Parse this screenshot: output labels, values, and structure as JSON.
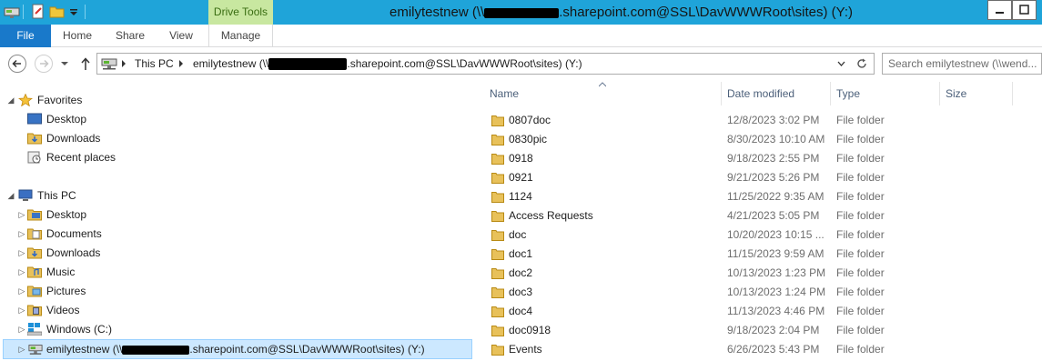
{
  "ribbon": {
    "context_tab": "Drive Tools",
    "tabs": [
      "File",
      "Home",
      "Share",
      "View",
      "Manage"
    ]
  },
  "window": {
    "title_pre": "emilytestnew (\\\\",
    "title_post": ".sharepoint.com@SSL\\DavWWWRoot\\sites) (Y:)"
  },
  "address": {
    "crumb1": "This PC",
    "crumb2_pre": "emilytestnew (\\\\",
    "crumb2_post": ".sharepoint.com@SSL\\DavWWWRoot\\sites) (Y:)"
  },
  "search": {
    "placeholder": "Search emilytestnew (\\\\wend..."
  },
  "navpane": {
    "favorites": {
      "label": "Favorites",
      "items": [
        "Desktop",
        "Downloads",
        "Recent places"
      ]
    },
    "thispc": {
      "label": "This PC",
      "items": [
        "Desktop",
        "Documents",
        "Downloads",
        "Music",
        "Pictures",
        "Videos",
        "Windows (C:)"
      ]
    },
    "network_drive": {
      "pre": "emilytestnew (\\\\",
      "post": ".sharepoint.com@SSL\\DavWWWRoot\\sites) (Y:)"
    }
  },
  "columns": {
    "name": "Name",
    "date": "Date modified",
    "type": "Type",
    "size": "Size"
  },
  "files": [
    {
      "name": "0807doc",
      "date": "12/8/2023 3:02 PM",
      "type": "File folder"
    },
    {
      "name": "0830pic",
      "date": "8/30/2023 10:10 AM",
      "type": "File folder"
    },
    {
      "name": "0918",
      "date": "9/18/2023 2:55 PM",
      "type": "File folder"
    },
    {
      "name": "0921",
      "date": "9/21/2023 5:26 PM",
      "type": "File folder"
    },
    {
      "name": "1124",
      "date": "11/25/2022 9:35 AM",
      "type": "File folder"
    },
    {
      "name": "Access Requests",
      "date": "4/21/2023 5:05 PM",
      "type": "File folder"
    },
    {
      "name": "doc",
      "date": "10/20/2023 10:15 ...",
      "type": "File folder"
    },
    {
      "name": "doc1",
      "date": "11/15/2023 9:59 AM",
      "type": "File folder"
    },
    {
      "name": "doc2",
      "date": "10/13/2023 1:23 PM",
      "type": "File folder"
    },
    {
      "name": "doc3",
      "date": "10/13/2023 1:24 PM",
      "type": "File folder"
    },
    {
      "name": "doc4",
      "date": "11/13/2023 4:46 PM",
      "type": "File folder"
    },
    {
      "name": "doc0918",
      "date": "9/18/2023 2:04 PM",
      "type": "File folder"
    },
    {
      "name": "Events",
      "date": "6/26/2023 5:43 PM",
      "type": "File folder"
    }
  ],
  "colors": {
    "titlebar": "#1fa4d9",
    "context_tab": "#c8e7a0",
    "file_tab": "#1979ca",
    "selection": "#cce8ff",
    "folder": "#e8c15a"
  },
  "icons": {
    "qat": [
      "drive-icon",
      "properties-icon",
      "new-folder-icon",
      "customize-qat-icon"
    ],
    "nav": [
      "back-arrow-icon",
      "forward-arrow-icon",
      "recent-locations-icon",
      "up-arrow-icon",
      "refresh-icon"
    ]
  }
}
